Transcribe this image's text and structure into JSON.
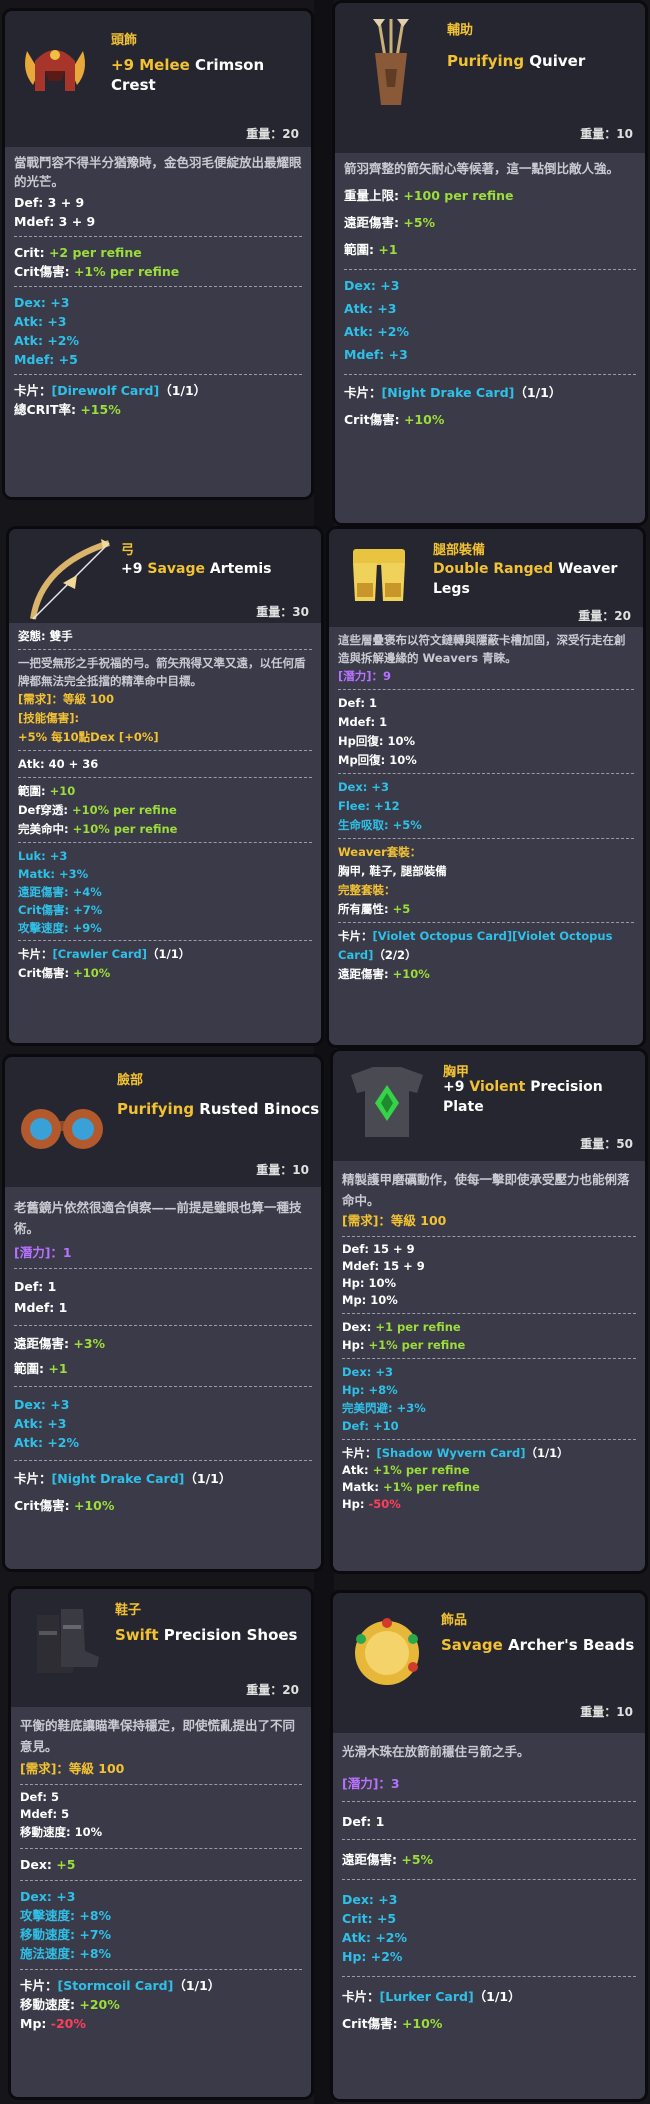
{
  "cards": [
    {
      "slot": "頭飾",
      "name_prefix": "+9 Melee",
      "name_rest": " Crimson Crest",
      "weight": "重量：20",
      "desc": "當戰鬥容不得半分猶豫時，金色羽毛便綻放出最耀眼的光芒。",
      "base": [
        "Def: 3 + 9",
        "Mdef: 3 + 9"
      ],
      "refine": [
        {
          "k": "Crit: ",
          "v": "+2 per refine"
        },
        {
          "k": "Crit傷害: ",
          "v": "+1% per refine"
        }
      ],
      "bonus": [
        {
          "k": "Dex: ",
          "v": "+3"
        },
        {
          "k": "Atk: ",
          "v": "+3"
        },
        {
          "k": "Atk: ",
          "v": "+2%"
        },
        {
          "k": "Mdef: ",
          "v": "+5"
        }
      ],
      "card_label": "卡片：",
      "card_name": "[Direwolf Card]",
      "card_count": "（1/1）",
      "card_effect_k": "總CRIT率: ",
      "card_effect_v": "+15%"
    },
    {
      "slot": "輔助",
      "name_prefix": "Purifying",
      "name_rest": " Quiver",
      "weight": "重量：10",
      "desc": "箭羽齊整的箭矢耐心等候著，這一點倒比敵人強。",
      "stats1": [
        {
          "k": "重量上限: ",
          "v": "+100 per refine"
        },
        {
          "k": "遠距傷害: ",
          "v": "+5%"
        },
        {
          "k": "範圍: ",
          "v": "+1"
        }
      ],
      "bonus": [
        {
          "k": "Dex: ",
          "v": "+3"
        },
        {
          "k": "Atk: ",
          "v": "+3"
        },
        {
          "k": "Atk: ",
          "v": "+2%"
        },
        {
          "k": "Mdef: ",
          "v": "+3"
        }
      ],
      "card_label": "卡片：",
      "card_name": "[Night Drake Card]",
      "card_count": "（1/1）",
      "card_effect_k": "Crit傷害: ",
      "card_effect_v": "+10%"
    },
    {
      "slot": "弓",
      "name_pre": "+9 ",
      "name_prefix": "Savage",
      "name_rest": " Artemis",
      "weight": "重量：30",
      "type_line": "姿態: 雙手",
      "desc": "一把受無形之手祝福的弓。箭矢飛得又準又遠，以任何盾牌都無法完全抵擋的精準命中目標。",
      "req": "[需求]：等級 100",
      "skill_label": "[技能傷害]:",
      "skill_val": "+5% 每10點Dex [+0%]",
      "atk": "Atk: 40 + 36",
      "stats1": [
        {
          "k": "範圍: ",
          "v": "+10"
        },
        {
          "k": "Def穿透: ",
          "v": "+10% per refine"
        },
        {
          "k": "完美命中: ",
          "v": "+10% per refine"
        }
      ],
      "bonus": [
        {
          "k": "Luk: ",
          "v": "+3"
        },
        {
          "k": "Matk: ",
          "v": "+3%"
        },
        {
          "k": "遠距傷害: ",
          "v": "+4%"
        },
        {
          "k": "Crit傷害: ",
          "v": "+7%"
        },
        {
          "k": "攻擊速度: ",
          "v": "+9%"
        }
      ],
      "card_label": "卡片：",
      "card_name": "[Crawler Card]",
      "card_count": "（1/1）",
      "card_effect_k": "Crit傷害: ",
      "card_effect_v": "+10%"
    },
    {
      "slot": "腿部裝備",
      "name_prefix": "Double Ranged",
      "name_rest": " Weaver Legs",
      "weight": "重量：20",
      "desc": "這些層疊褒布以符文鏈轉與隱蔽卡槽加固，深受行走在創造與拆解邊緣的 Weavers 青睞。",
      "potential": "[潛力]：9",
      "base": [
        "Def: 1",
        "Mdef: 1",
        "Hp回復: 10%",
        "Mp回復: 10%"
      ],
      "bonus": [
        {
          "k": "Dex: ",
          "v": "+3"
        },
        {
          "k": "Flee: ",
          "v": "+12"
        },
        {
          "k": "生命吸取: ",
          "v": "+5%"
        }
      ],
      "set_label": "Weaver套裝：",
      "set_items": "胸甲, 鞋子, 腿部裝備",
      "set_full_label": "完整套裝：",
      "set_full_k": "所有屬性: ",
      "set_full_v": "+5",
      "card_label": "卡片：",
      "card_name": "[Violet Octopus Card][Violet Octopus Card]",
      "card_count": "（2/2）",
      "card_effect_k": "遠距傷害: ",
      "card_effect_v": "+10%"
    },
    {
      "slot": "臉部",
      "name_prefix": "Purifying",
      "name_rest": " Rusted Binocs",
      "weight": "重量：10",
      "desc": "老舊鏡片依然很適合偵察——前提是雖眼也算一種技術。",
      "potential": "[潛力]：1",
      "base": [
        "Def: 1",
        "Mdef: 1"
      ],
      "stats1": [
        {
          "k": "遠距傷害: ",
          "v": "+3%"
        },
        {
          "k": "範圍: ",
          "v": "+1"
        }
      ],
      "bonus": [
        {
          "k": "Dex: ",
          "v": "+3"
        },
        {
          "k": "Atk: ",
          "v": "+3"
        },
        {
          "k": "Atk: ",
          "v": "+2%"
        }
      ],
      "card_label": "卡片：",
      "card_name": "[Night Drake Card]",
      "card_count": "（1/1）",
      "card_effect_k": "Crit傷害: ",
      "card_effect_v": "+10%"
    },
    {
      "slot": "胸甲",
      "name_pre": "+9 ",
      "name_prefix": "Violent",
      "name_rest": " Precision Plate",
      "weight": "重量：50",
      "desc": "精製護甲磨礪動作，使每一擊即使承受壓力也能俐落命中。",
      "req": "[需求]：等級 100",
      "base": [
        "Def: 15 + 9",
        "Mdef: 15 + 9",
        "Hp: 10%",
        "Mp: 10%"
      ],
      "refine": [
        {
          "k": "Dex: ",
          "v": "+1 per refine"
        },
        {
          "k": "Hp: ",
          "v": "+1% per refine"
        }
      ],
      "bonus": [
        {
          "k": "Dex: ",
          "v": "+3"
        },
        {
          "k": "Hp: ",
          "v": "+8%"
        },
        {
          "k": "完美閃避: ",
          "v": "+3%"
        },
        {
          "k": "Def: ",
          "v": "+10"
        }
      ],
      "card_label": "卡片：",
      "card_name": "[Shadow Wyvern Card]",
      "card_count": "（1/1）",
      "card_effects": [
        {
          "k": "Atk: ",
          "v": "+1% per refine",
          "cls": "g"
        },
        {
          "k": "Matk: ",
          "v": "+1% per refine",
          "cls": "g"
        },
        {
          "k": "Hp: ",
          "v": "-50%",
          "cls": "r"
        }
      ]
    },
    {
      "slot": "鞋子",
      "name_prefix": "Swift",
      "name_rest": " Precision Shoes",
      "weight": "重量：20",
      "desc": "平衡的鞋底讓瞄準保持穩定，即使慌亂提出了不同意見。",
      "req": "[需求]：等級 100",
      "base": [
        "Def: 5",
        "Mdef: 5",
        "移動速度: 10%"
      ],
      "stats1": [
        {
          "k": "Dex: ",
          "v": "+5"
        }
      ],
      "bonus": [
        {
          "k": "Dex: ",
          "v": "+3"
        },
        {
          "k": "攻擊速度: ",
          "v": "+8%"
        },
        {
          "k": "移動速度: ",
          "v": "+7%"
        },
        {
          "k": "施法速度: ",
          "v": "+8%"
        }
      ],
      "card_label": "卡片：",
      "card_name": "[Stormcoil Card]",
      "card_count": "（1/1）",
      "card_effects": [
        {
          "k": "移動速度: ",
          "v": "+20%",
          "cls": "g"
        },
        {
          "k": "Mp: ",
          "v": "-20%",
          "cls": "r"
        }
      ]
    },
    {
      "slot": "飾品",
      "name_prefix": "Savage",
      "name_rest": " Archer's Beads",
      "weight": "重量：10",
      "desc": "光滑木珠在放箭前穩住弓箭之手。",
      "potential": "[潛力]：3",
      "base": [
        "Def: 1"
      ],
      "stats1": [
        {
          "k": "遠距傷害: ",
          "v": "+5%"
        }
      ],
      "bonus": [
        {
          "k": "Dex: ",
          "v": "+3"
        },
        {
          "k": "Crit: ",
          "v": "+5"
        },
        {
          "k": "Atk: ",
          "v": "+2%"
        },
        {
          "k": "Hp: ",
          "v": "+2%"
        }
      ],
      "card_label": "卡片：",
      "card_name": "[Lurker Card]",
      "card_count": "（1/1）",
      "card_effect_k": "Crit傷害: ",
      "card_effect_v": "+10%"
    }
  ]
}
